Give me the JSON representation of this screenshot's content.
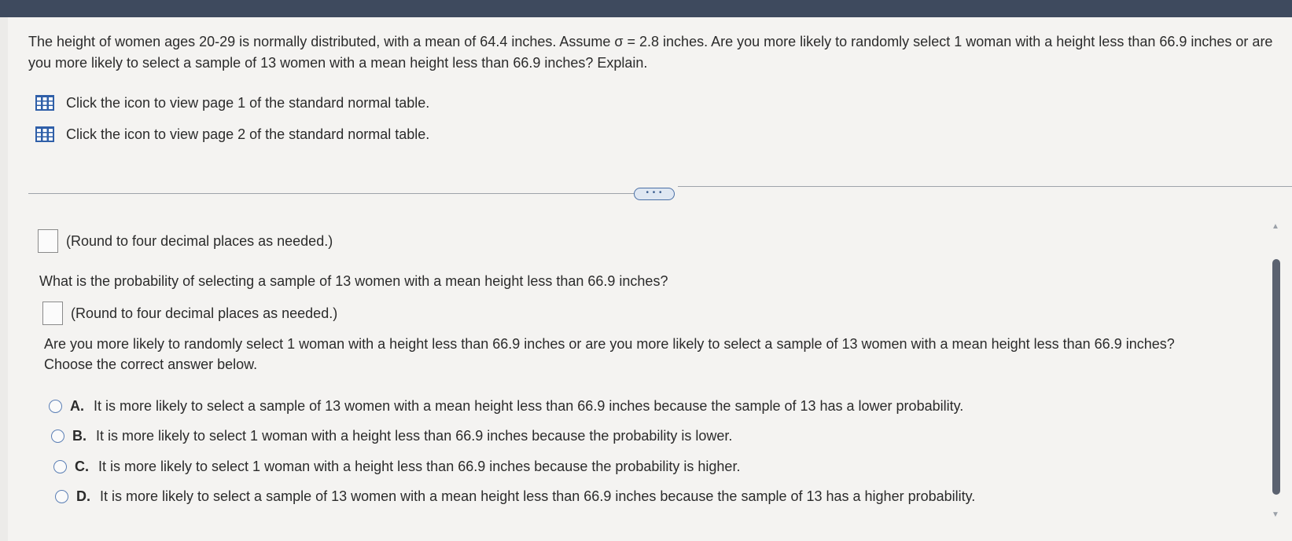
{
  "question": {
    "text": "The height of women ages 20-29 is normally distributed, with a mean of 64.4 inches. Assume σ = 2.8 inches. Are you more likely to randomly select 1 woman with a height less than 66.9 inches or are you more likely to select a sample of 13 women with a mean height less than 66.9 inches? Explain."
  },
  "table_links": [
    {
      "label": "Click the icon to view page 1 of the standard normal table.",
      "icon": "table-icon"
    },
    {
      "label": "Click the icon to view page 2 of the standard normal table.",
      "icon": "table-icon"
    }
  ],
  "expand_button": {
    "label": "• • •"
  },
  "part1": {
    "answer_value": "",
    "hint": "(Round to four decimal places as needed.)"
  },
  "part2": {
    "prompt": "What is the probability of selecting a sample of 13 women with a mean height less than 66.9 inches?",
    "answer_value": "",
    "hint": "(Round to four decimal places as needed.)"
  },
  "part3": {
    "prompt": "Are you more likely to randomly select 1 woman with a height less than 66.9 inches or are you more likely to select a sample of 13 women with a mean height less than 66.9 inches? Choose the correct answer below.",
    "options": [
      {
        "letter": "A.",
        "text": "It is more likely to select a sample of 13 women with a mean height less than 66.9 inches because the sample of 13 has a lower probability."
      },
      {
        "letter": "B.",
        "text": "It is more likely to select 1 woman with a height less than 66.9 inches because the probability is lower."
      },
      {
        "letter": "C.",
        "text": "It is more likely to select 1 woman with a height less than 66.9 inches because the probability is higher."
      },
      {
        "letter": "D.",
        "text": "It is more likely to select a sample of 13 women with a mean height less than 66.9 inches because the sample of 13 has a higher probability."
      }
    ]
  },
  "colors": {
    "accent": "#2f5fa8",
    "radio_border": "#5b7fb5"
  }
}
